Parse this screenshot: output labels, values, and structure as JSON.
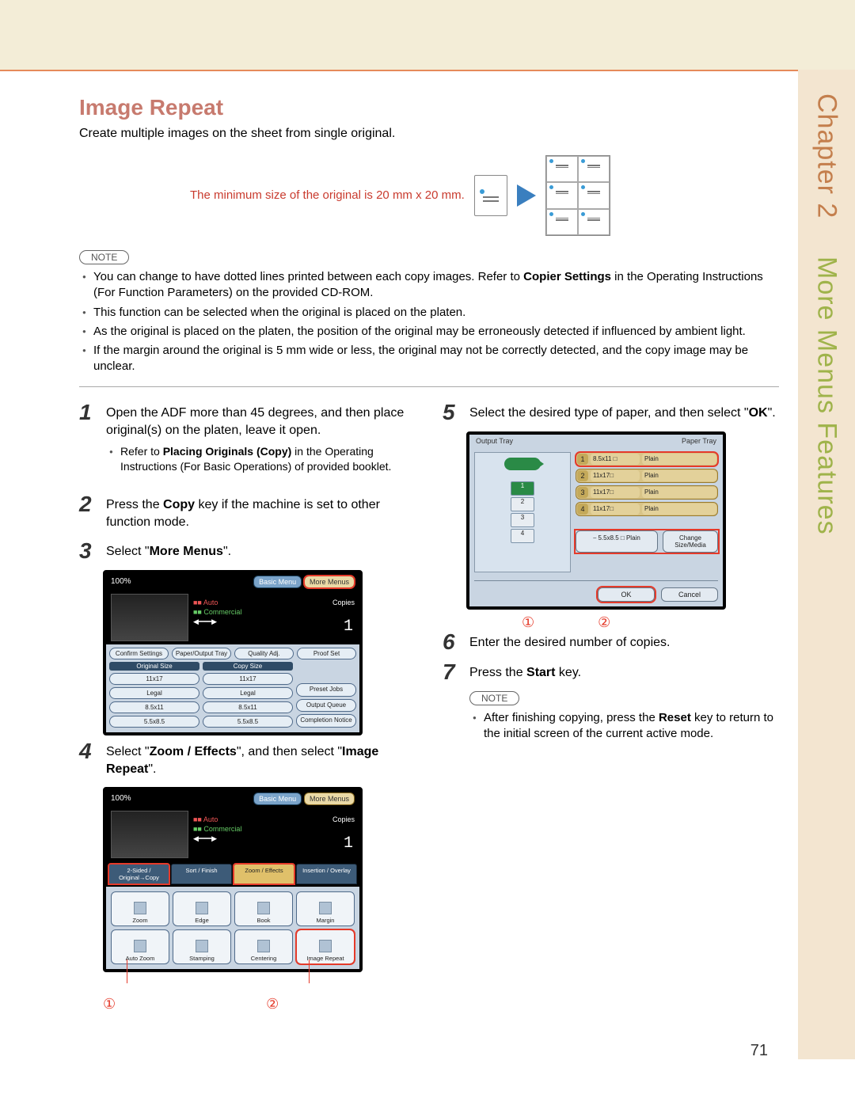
{
  "side": {
    "chapter": "Chapter 2",
    "title": "More Menus Features"
  },
  "heading": "Image Repeat",
  "intro": "Create multiple images on the sheet from single original.",
  "red_note": "The minimum size of the original is 20 mm x 20 mm.",
  "note_label": "NOTE",
  "notes": [
    {
      "pre": "You can change to have dotted lines printed between each copy images. Refer to ",
      "strong": "Copier Settings",
      "post": " in the Operating Instructions (For Function Parameters) on the provided CD-ROM."
    },
    {
      "pre": "This function can be selected when the original is placed on the platen.",
      "strong": "",
      "post": ""
    },
    {
      "pre": "As the original is placed on the platen, the position of the original may be erroneously detected if influenced by ambient light.",
      "strong": "",
      "post": ""
    },
    {
      "pre": "If the margin around the original is 5 mm wide or less, the original may not be correctly detected, and the copy image may be unclear.",
      "strong": "",
      "post": ""
    }
  ],
  "steps_left": {
    "s1": {
      "text": "Open the ADF more than 45 degrees, and then place original(s) on the platen, leave it open.",
      "sub": {
        "pre": "Refer to ",
        "strong": "Placing Originals (Copy)",
        "post": " in the Operating Instructions (For Basic Operations) of provided booklet."
      }
    },
    "s2": {
      "pre": "Press the ",
      "strong": "Copy",
      "post": " key if the machine is set to other function mode."
    },
    "s3": {
      "pre": "Select \"",
      "strong": "More Menus",
      "post": "\"."
    },
    "s4": {
      "pre": "Select \"",
      "strong1": "Zoom / Effects",
      "mid": "\", and then select \"",
      "strong2": "Image Repeat",
      "post": "\"."
    }
  },
  "steps_right": {
    "s5": {
      "pre": "Select the desired type of paper, and then select \"",
      "strong": "OK",
      "post": "\"."
    },
    "s6": "Enter the desired number of copies.",
    "s7": {
      "pre": "Press the ",
      "strong": "Start",
      "post": " key."
    },
    "note": {
      "pre": "After finishing copying, press the ",
      "strong": "Reset",
      "post": " key to return to the initial screen of the current active mode."
    }
  },
  "ui_a": {
    "zoom": "100%",
    "basic": "Basic Menu",
    "more": "More Menus",
    "auto": "Auto",
    "commercial": "Commercial",
    "copies_lbl": "Copies",
    "copies_val": "1",
    "row1": [
      "Confirm Settings",
      "Paper/Output Tray",
      "Quality Adj.",
      "Proof Set"
    ],
    "h1": "Original Size",
    "h2": "Copy Size",
    "sizes_l": [
      "11x17",
      "Legal",
      "8.5x11",
      "5.5x8.5"
    ],
    "sizes_r": [
      "11x17",
      "Legal",
      "8.5x11",
      "5.5x8.5"
    ],
    "side_btns": [
      "Preset Jobs",
      "Output Queue",
      "Completion Notice"
    ]
  },
  "ui_b": {
    "zoom": "100%",
    "basic": "Basic Menu",
    "more": "More Menus",
    "auto": "Auto",
    "commercial": "Commercial",
    "copies_lbl": "Copies",
    "copies_val": "1",
    "tabs": [
      "2-Sided / Original→Copy",
      "Sort / Finish",
      "Zoom / Effects",
      "Insertion / Overlay"
    ],
    "eff": [
      "Zoom",
      "Edge",
      "Book",
      "Margin",
      "Auto Zoom",
      "Stamping",
      "Centering",
      "Image Repeat"
    ]
  },
  "ui_c": {
    "top_l": "Output Tray",
    "top_r": "Paper Tray",
    "trays": [
      "1",
      "2",
      "3",
      "4"
    ],
    "rows": [
      {
        "n": "1",
        "sz": "8.5x11 □",
        "tp": "Plain"
      },
      {
        "n": "2",
        "sz": "11x17□",
        "tp": "Plain"
      },
      {
        "n": "3",
        "sz": "11x17□",
        "tp": "Plain"
      },
      {
        "n": "4",
        "sz": "11x17□",
        "tp": "Plain"
      }
    ],
    "bypass": "5.5x8.5 □ Plain",
    "change": "Change Size/Media",
    "ok": "OK",
    "cancel": "Cancel"
  },
  "callout1": "①",
  "callout2": "②",
  "page_number": "71"
}
